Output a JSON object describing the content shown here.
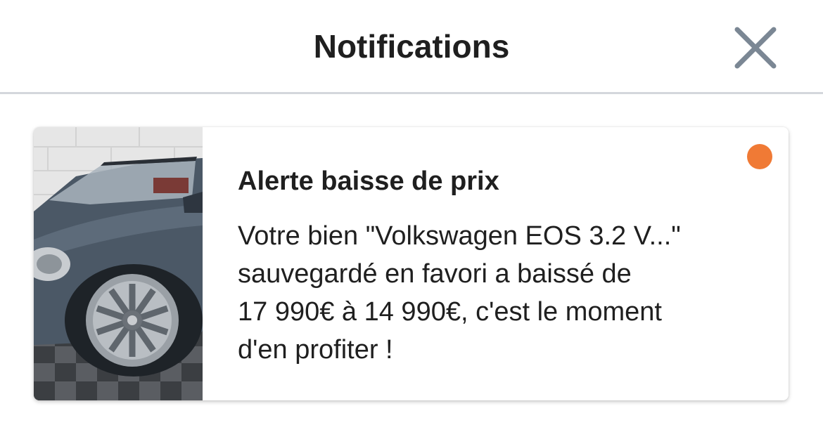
{
  "header": {
    "title": "Notifications",
    "close_icon": "close-icon"
  },
  "notifications": [
    {
      "title": "Alerte baisse de prix",
      "body_lines": [
        "Votre bien \"Volkswagen EOS 3.2 V...\"",
        "sauvegardé en favori a baissé de",
        "17 990€ à 14 990€, c'est le moment",
        "d'en profiter !"
      ],
      "image_icon": "car-photo",
      "unread": true
    }
  ],
  "colors": {
    "unread_dot": "#f07a35",
    "close_icon": "#7b8794",
    "divider": "#d4d7dc"
  }
}
